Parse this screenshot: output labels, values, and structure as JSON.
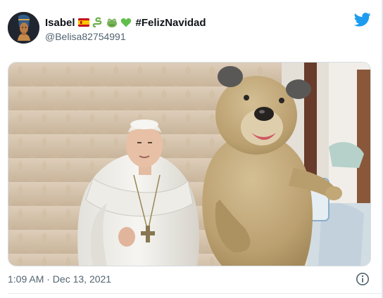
{
  "tweet": {
    "display_name": "Isabel",
    "hashtag": "#FelizNavidad",
    "handle": "@Belisa82754991",
    "timestamp": "1:09 AM · Dec 13, 2021",
    "emojis": [
      "spain-flag-emoji",
      "green-snake-emoji",
      "frog-face-emoji",
      "green-heart-emoji"
    ],
    "colors": {
      "twitter_blue": "#1d9bf0",
      "text_primary": "#0f1419",
      "text_secondary": "#536471"
    }
  }
}
